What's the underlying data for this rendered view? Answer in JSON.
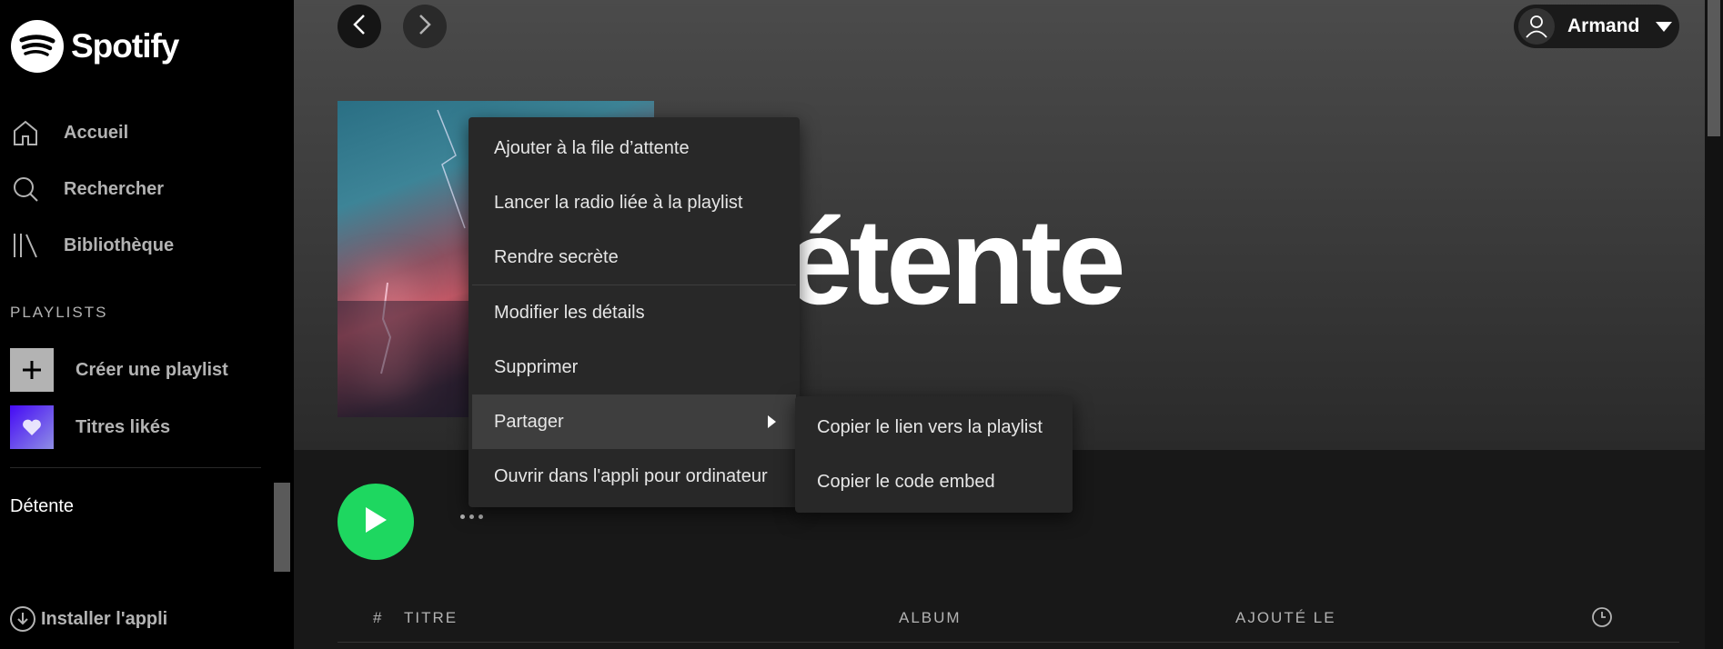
{
  "brand": {
    "name": "Spotify"
  },
  "sidebar": {
    "nav": [
      {
        "label": "Accueil",
        "icon": "home-icon"
      },
      {
        "label": "Rechercher",
        "icon": "search-icon"
      },
      {
        "label": "Bibliothèque",
        "icon": "library-icon"
      }
    ],
    "playlists_title": "PLAYLISTS",
    "create_playlist": "Créer une playlist",
    "liked_songs": "Titres likés",
    "current_playlist": "Détente",
    "install_app": "Installer l'appli"
  },
  "header": {
    "user_name": "Armand"
  },
  "playlist": {
    "title_visible": "étente"
  },
  "table": {
    "columns": [
      "#",
      "TITRE",
      "ALBUM",
      "AJOUTÉ LE"
    ],
    "duration_icon": "clock-icon"
  },
  "context_menu": {
    "items": [
      "Ajouter à la file d’attente",
      "Lancer la radio liée à la playlist",
      "Rendre secrète",
      "Modifier les détails",
      "Supprimer",
      "Partager",
      "Ouvrir dans l'appli pour ordinateur"
    ],
    "active_item": "Partager"
  },
  "share_submenu": {
    "items": [
      "Copier le lien vers la playlist",
      "Copier le code embed"
    ]
  },
  "colors": {
    "accent": "#1ed760",
    "background": "#121212",
    "sidebar": "#000000",
    "menu": "#282828"
  }
}
